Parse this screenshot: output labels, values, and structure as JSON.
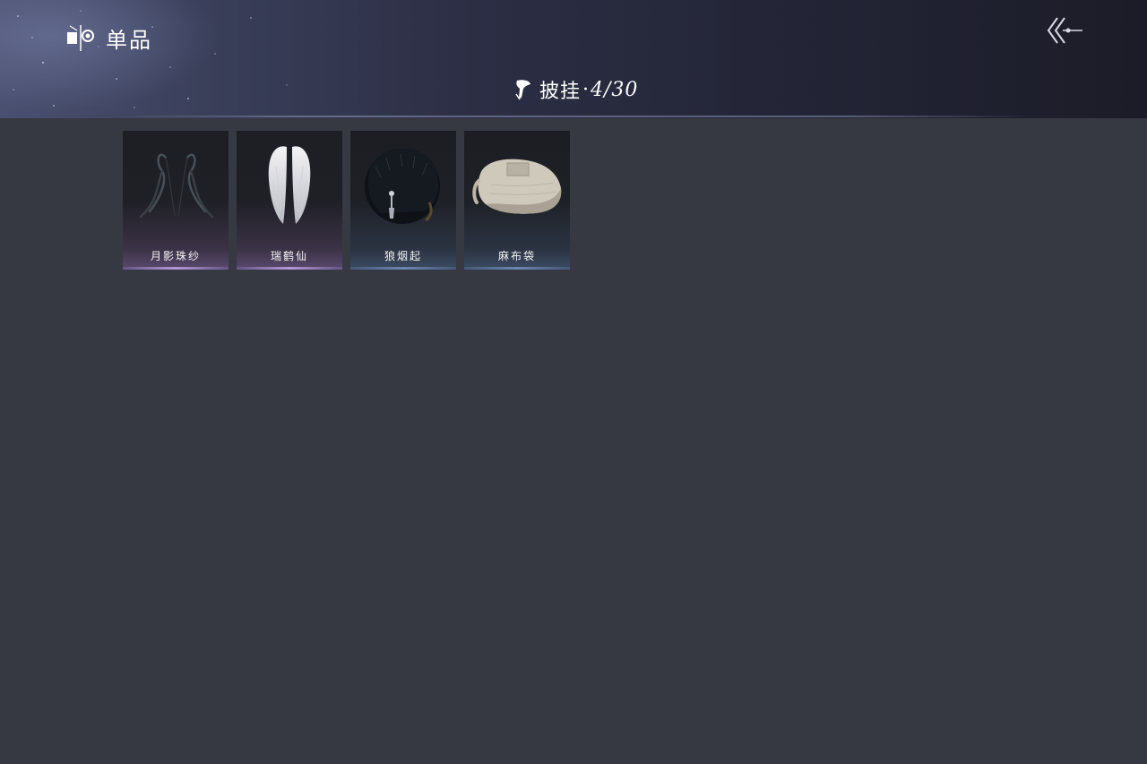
{
  "header": {
    "title": "单品",
    "title_icon": "wardrobe-icon",
    "back_icon": "back-arrow-icon"
  },
  "category": {
    "icon": "cape-icon",
    "label": "披挂",
    "separator": "·",
    "count": "4/30"
  },
  "items": [
    {
      "name": "月影珠纱",
      "rarity": "purple",
      "icon": "bead-veil-icon"
    },
    {
      "name": "瑞鹤仙",
      "rarity": "purple",
      "icon": "crane-wings-icon"
    },
    {
      "name": "狼烟起",
      "rarity": "blue",
      "icon": "wolf-fur-cape-icon"
    },
    {
      "name": "麻布袋",
      "rarity": "blue",
      "icon": "burlap-sack-icon"
    }
  ],
  "colors": {
    "background": "#363942",
    "rare_purple": "#be9ee6",
    "rare_blue": "#7896c8"
  }
}
